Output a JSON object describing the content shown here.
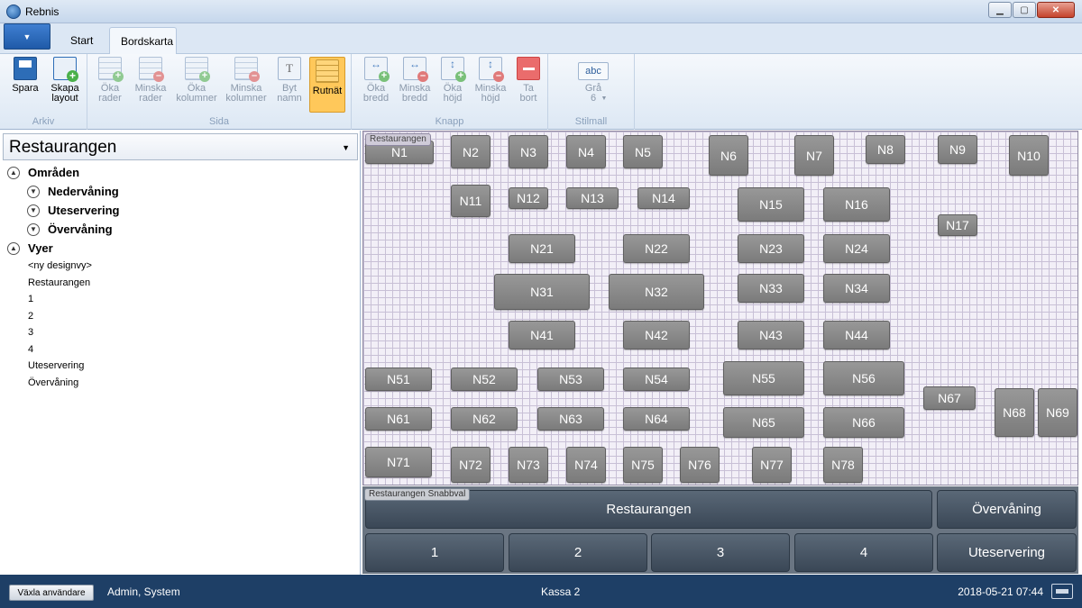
{
  "window": {
    "title": "Rebnis"
  },
  "ribbon": {
    "tabs": [
      "Start",
      "Bordskarta"
    ],
    "active_tab": "Bordskarta",
    "groups": {
      "arkiv": {
        "label": "Arkiv",
        "buttons": [
          {
            "label": "Spara",
            "icon": "save-icon"
          },
          {
            "label": "Skapa layout",
            "icon": "create-layout-icon"
          }
        ]
      },
      "sida": {
        "label": "Sida",
        "buttons": [
          {
            "label": "Öka rader",
            "icon": "add-rows-icon"
          },
          {
            "label": "Minska rader",
            "icon": "remove-rows-icon"
          },
          {
            "label": "Öka kolumner",
            "icon": "add-columns-icon"
          },
          {
            "label": "Minska kolumner",
            "icon": "remove-columns-icon"
          },
          {
            "label": "Byt namn",
            "icon": "rename-icon"
          },
          {
            "label": "Rutnät",
            "icon": "grid-icon"
          }
        ]
      },
      "knapp": {
        "label": "Knapp",
        "buttons": [
          {
            "label": "Öka bredd",
            "icon": "increase-width-icon"
          },
          {
            "label": "Minska bredd",
            "icon": "decrease-width-icon"
          },
          {
            "label": "Öka höjd",
            "icon": "increase-height-icon"
          },
          {
            "label": "Minska höjd",
            "icon": "decrease-height-icon"
          },
          {
            "label": "Ta bort",
            "icon": "remove-icon"
          }
        ]
      },
      "stilmall": {
        "label": "Stilmall",
        "sample": "abc",
        "value": "Grå 6"
      }
    }
  },
  "left": {
    "selected_view": "Restaurangen",
    "omraden": {
      "label": "Områden",
      "items": [
        "Nedervåning",
        "Uteservering",
        "Övervåning"
      ]
    },
    "vyer": {
      "label": "Vyer",
      "items": [
        "<ny designvy>",
        "Restaurangen",
        "1",
        "2",
        "3",
        "4",
        "Uteservering",
        "Övervåning"
      ]
    }
  },
  "map": {
    "label": "Restaurangen",
    "tables": [
      "N1",
      "N2",
      "N3",
      "N4",
      "N5",
      "N6",
      "N7",
      "N8",
      "N9",
      "N10",
      "N11",
      "N12",
      "N13",
      "N14",
      "N15",
      "N16",
      "N17",
      "N21",
      "N22",
      "N23",
      "N24",
      "N31",
      "N32",
      "N33",
      "N34",
      "N41",
      "N42",
      "N43",
      "N44",
      "N51",
      "N52",
      "N53",
      "N54",
      "N55",
      "N56",
      "N61",
      "N62",
      "N63",
      "N64",
      "N65",
      "N66",
      "N67",
      "N68",
      "N69",
      "N71",
      "N72",
      "N73",
      "N74",
      "N75",
      "N76",
      "N77",
      "N78"
    ]
  },
  "quick": {
    "label": "Restaurangen Snabbval",
    "buttons": [
      "Restaurangen",
      "Övervåning",
      "1",
      "2",
      "3",
      "4",
      "Uteservering"
    ]
  },
  "status": {
    "switch_user": "Växla användare",
    "user": "Admin, System",
    "register": "Kassa 2",
    "datetime": "2018-05-21 07:44"
  }
}
